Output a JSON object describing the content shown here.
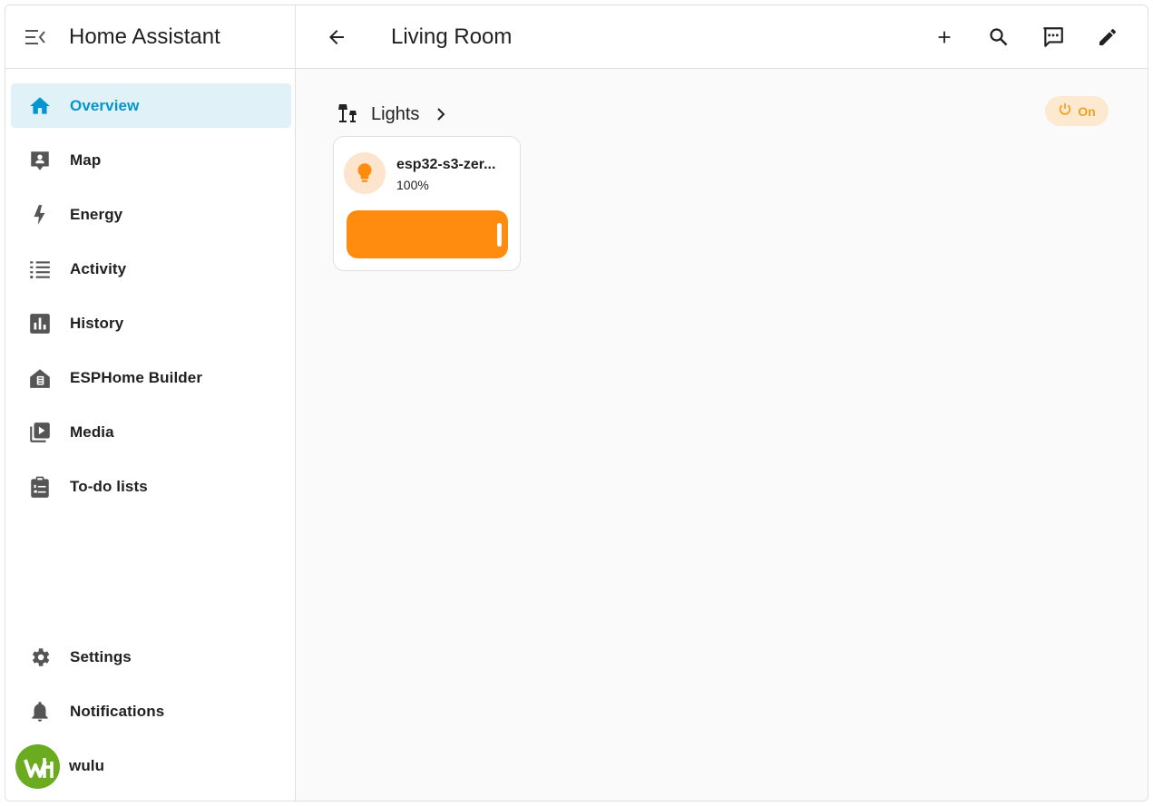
{
  "sidebar": {
    "title": "Home Assistant",
    "items": [
      {
        "label": "Overview",
        "icon": "home-icon",
        "active": true
      },
      {
        "label": "Map",
        "icon": "map-icon"
      },
      {
        "label": "Energy",
        "icon": "lightning-icon"
      },
      {
        "label": "Activity",
        "icon": "list-icon"
      },
      {
        "label": "History",
        "icon": "chart-icon"
      },
      {
        "label": "ESPHome Builder",
        "icon": "esphome-icon"
      },
      {
        "label": "Media",
        "icon": "media-icon"
      },
      {
        "label": "To-do lists",
        "icon": "clipboard-list-icon"
      }
    ],
    "bottom": [
      {
        "label": "Settings",
        "icon": "gear-icon"
      },
      {
        "label": "Notifications",
        "icon": "bell-icon"
      }
    ],
    "user": {
      "name": "wulu"
    }
  },
  "header": {
    "title": "Living Room",
    "actions": [
      "plus-icon",
      "search-icon",
      "assist-icon",
      "pencil-icon"
    ]
  },
  "section": {
    "title": "Lights",
    "toggle_label": "On"
  },
  "light": {
    "name": "esp32-s3-zer...",
    "state": "100%",
    "brightness": 100
  },
  "colors": {
    "accent": "#0396cf",
    "active_bg": "#e1f1f8",
    "light_on": "#ff8c0f",
    "light_bg": "#fde4cc",
    "badge_text": "#f0a21c"
  }
}
